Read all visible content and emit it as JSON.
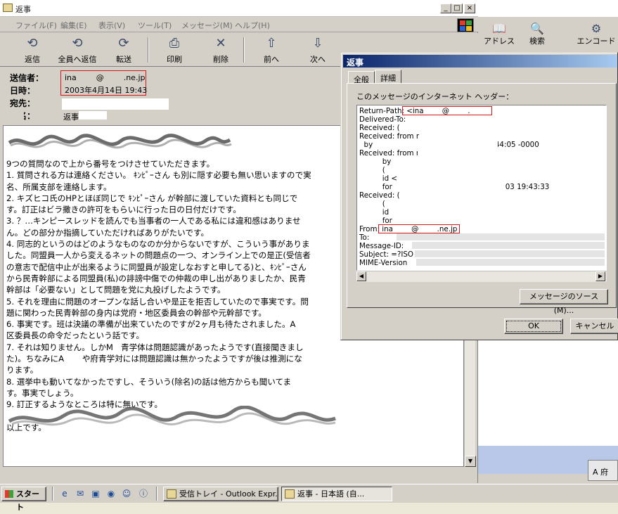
{
  "main_window": {
    "title": "返事",
    "menu": [
      "ファイル(F)",
      "編集(E)",
      "表示(V)",
      "ツール(T)",
      "メッセージ(M)",
      "ヘルプ(H)"
    ],
    "toolbar": [
      "返信",
      "全員へ返信",
      "転送",
      "印刷",
      "削除",
      "前へ",
      "次へ"
    ],
    "header_labels": {
      "from": "送信者：",
      "date": "日時：",
      "to": "宛先：",
      "subject": "件名："
    },
    "header_values": {
      "from": "ina        @        .ne.jp",
      "date": "2003年4月14日 19:43",
      "subject": "返事"
    },
    "body_lines": [
      "9つの質問なので上から番号をつけさせていただきます。",
      "1. 質問される方は連絡ください。 ｷﾝﾋﾟｰさん も別に隠す必要も無い思いますので実",
      "名、所属支部を連絡します。",
      "2. キズヒコ氏のHPとほぼ同じで ｷﾝﾋﾟｰさん が幹部に渡していた資料とも同じで",
      "す。訂正はビラ撒きの許可をもらいに行った日の日付だけです。",
      "3. ？…キンピースレッドを読んでも当事者の一人である私には違和感はありませ",
      "ん。どの部分か指摘していただければありがたいです。",
      "4. 同志的というのはどのようなものなのか分からないですが、こういう事がありま",
      "した。同盟員一人から変えるネットの問題点の一つ、オンライン上での是正(受信者",
      "の意志で配信中止が出来るように同盟員が設定しなおすと申してる)と、ｷﾝﾋﾟｰさん",
      "から民青幹部による同盟員(私)の誹謗中傷での仲裁の申し出がありましたか、民青",
      "幹部は「必要ない」として問題を党に丸投げしたようです。",
      "5. それを理由に問題のオープンな話し合いや是正を拒否していたので事実です。問",
      "題に関わった民青幹部の身内は党府・地区委員会の幹部や元幹部です。",
      "6. 事実です。班は決議の準備が出来ていたのですが2ヶ月も待たされました。A",
      "区委員長の命令だったという話です。",
      "7. それは知りません。しかM   青学体は問題認識があったようです(直接聞きまし",
      "た)。ちなみにA       や府青学対には問題認識は無かったようですが後は推測にな",
      "ります。",
      "8. 選挙中も動いてなかったですし、そういう(除名)の話は他方からも聞いてま",
      "す。事実でしょう。",
      "9. 訂正するようなところは特に無いです。",
      "",
      "以上です。"
    ]
  },
  "right_app": {
    "toolbar": [
      "アドレス",
      "検索",
      "エンコード"
    ],
    "mini_label": "A 府"
  },
  "dialog": {
    "title": "返事",
    "tabs": [
      "全般",
      "詳細"
    ],
    "active_tab": "詳細",
    "headers_label": "このメッセージのインターネット ヘッダー：",
    "header_lines": [
      "Return-Path: <ina        @        .ne.jp>",
      "Delivered-To:",
      "Received: (",
      "Received: from m",
      "  by                                       2003 10:44:05 -0000",
      "Received: from m",
      "          by",
      "          (",
      "          id <",
      "          for                       ; Mon, 14 Apr 2003 19:43:33",
      "Received: (                              .ne.jp",
      "          (",
      "          id",
      "          for                           Apr 2003 19:43:33",
      "From: ina        @        .ne.jp",
      "To:",
      "Message-ID:",
      "Subject: =?ISO",
      "MIME-Version"
    ],
    "source_button": "メッセージのソース(M)...",
    "ok_button": "OK",
    "cancel_button": "キャンセル"
  },
  "taskbar": {
    "start": "スタート",
    "tasks": [
      "受信トレイ - Outlook Expr...",
      "返事 - 日本語 (自..."
    ]
  }
}
